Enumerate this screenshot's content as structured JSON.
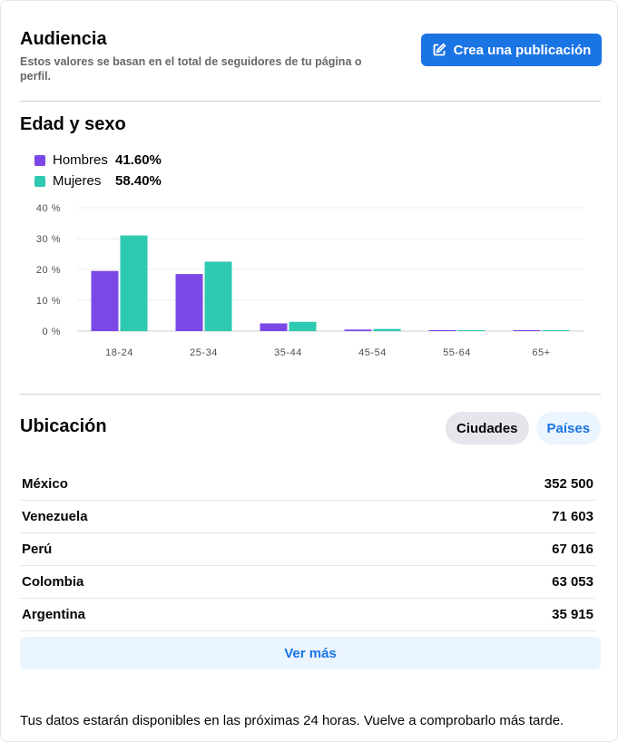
{
  "header": {
    "title": "Audiencia",
    "subtitle": "Estos valores se basan en el total de seguidores de tu página o perfil.",
    "create_button": "Crea una publicación"
  },
  "age_gender": {
    "title": "Edad y sexo",
    "legend": [
      {
        "label": "Hombres",
        "value": "41.60%",
        "color": "#7b47e6"
      },
      {
        "label": "Mujeres",
        "value": "58.40%",
        "color": "#2ec9b1"
      }
    ]
  },
  "chart_data": {
    "type": "bar",
    "categories": [
      "18-24",
      "25-34",
      "35-44",
      "45-54",
      "55-64",
      "65+"
    ],
    "series": [
      {
        "name": "Hombres",
        "color": "#7b47e6",
        "values": [
          19.5,
          18.5,
          2.5,
          0.5,
          0.2,
          0.2
        ]
      },
      {
        "name": "Mujeres",
        "color": "#2ec9b1",
        "values": [
          31,
          22.5,
          3,
          0.7,
          0.2,
          0.2
        ]
      }
    ],
    "yticks": [
      "0 %",
      "10 %",
      "20 %",
      "30 %",
      "40 %"
    ],
    "ylim": [
      0,
      40
    ],
    "grid": true
  },
  "location": {
    "title": "Ubicación",
    "tabs": [
      "Ciudades",
      "Países"
    ],
    "rows": [
      {
        "name": "México",
        "value": "352 500"
      },
      {
        "name": "Venezuela",
        "value": "71 603"
      },
      {
        "name": "Perú",
        "value": "67 016"
      },
      {
        "name": "Colombia",
        "value": "63 053"
      },
      {
        "name": "Argentina",
        "value": "35 915"
      }
    ],
    "more_button": "Ver más"
  },
  "footer": {
    "note": "Tus datos estarán disponibles en las próximas 24 horas. Vuelve a comprobarlo más tarde."
  }
}
